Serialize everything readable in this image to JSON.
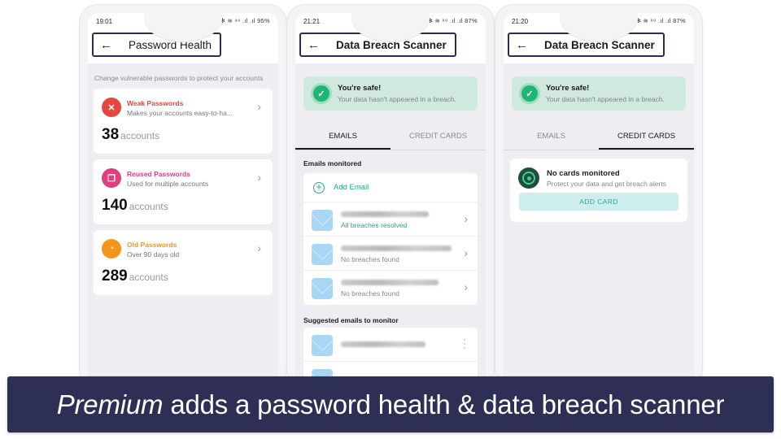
{
  "phones": [
    {
      "status": {
        "time": "19:01",
        "icons": "⸙ ✻ ≋ ⁹⁹ .ıl .ıl",
        "battery": "95%"
      },
      "title": "Password Health",
      "description": "Change vulnerable passwords to protect your accounts",
      "cards": [
        {
          "title": "Weak Passwords",
          "subtitle": "Makes your accounts easy-to-ha...",
          "count": "38",
          "unit": "accounts",
          "color": "#e5473f",
          "icon": "shield-x-icon"
        },
        {
          "title": "Reused Passwords",
          "subtitle": "Used for multiple accounts",
          "count": "140",
          "unit": "accounts",
          "color": "#e23e7d",
          "icon": "copy-icon"
        },
        {
          "title": "Old Passwords",
          "subtitle": "Over 90 days old",
          "count": "289",
          "unit": "accounts",
          "color": "#f2961c",
          "icon": "clock-icon"
        }
      ]
    },
    {
      "status": {
        "time": "21:21",
        "icons": "⸙ ✻ ≋ ⁹⁹ .ıl .ıl",
        "battery": "87%"
      },
      "title": "Data Breach Scanner",
      "banner": {
        "title": "You're safe!",
        "subtitle": "Your data hasn't appeared in a breach."
      },
      "tabs": [
        "EMAILS",
        "CREDIT CARDS"
      ],
      "active_tab": 0,
      "monitored_label": "Emails monitored",
      "add_email_label": "Add Email",
      "emails": [
        {
          "status": "All breaches resolved",
          "resolved": true
        },
        {
          "status": "No breaches found",
          "resolved": false
        },
        {
          "status": "No breaches found",
          "resolved": false
        }
      ],
      "suggested_label": "Suggested emails to monitor"
    },
    {
      "status": {
        "time": "21:20",
        "icons": "⸙ ✻ ≋ ⁹⁹ .ıl .ıl",
        "battery": "87%"
      },
      "title": "Data Breach Scanner",
      "banner": {
        "title": "You're safe!",
        "subtitle": "Your data hasn't appeared in a breach."
      },
      "tabs": [
        "EMAILS",
        "CREDIT CARDS"
      ],
      "active_tab": 1,
      "cards_empty": {
        "title": "No cards monitored",
        "subtitle": "Protect your data and get breach alerts",
        "button": "ADD CARD"
      }
    }
  ],
  "caption": {
    "emphasis": "Premium",
    "rest": "adds a password health & data breach scanner"
  }
}
